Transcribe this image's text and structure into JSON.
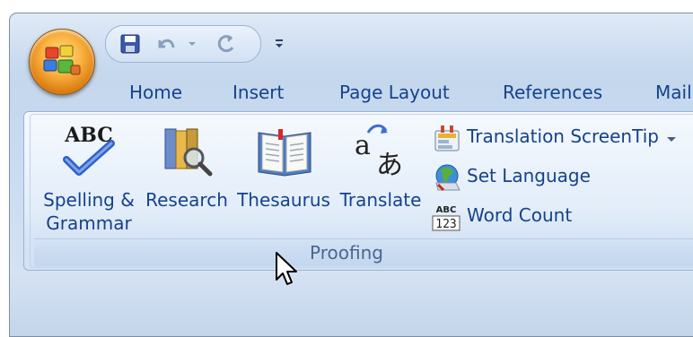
{
  "quick_access": {
    "icons": [
      "save-icon",
      "undo-icon",
      "dropdown-arrow-icon",
      "redo-icon",
      "customize-qat-icon"
    ]
  },
  "tabs": [
    {
      "label": "Home"
    },
    {
      "label": "Insert"
    },
    {
      "label": "Page Layout"
    },
    {
      "label": "References"
    },
    {
      "label": "Mail"
    }
  ],
  "group": {
    "label": "Proofing",
    "large_buttons": [
      {
        "line1": "Spelling &",
        "line2": "Grammar",
        "icon": "spelling-abc-check-icon"
      },
      {
        "line1": "Research",
        "line2": "",
        "icon": "research-books-magnifier-icon"
      },
      {
        "line1": "Thesaurus",
        "line2": "",
        "icon": "thesaurus-book-icon"
      },
      {
        "line1": "Translate",
        "line2": "",
        "icon": "translate-a-icon"
      }
    ],
    "small_buttons": [
      {
        "label": "Translation ScreenTip",
        "icon": "translation-screentip-icon",
        "has_dropdown": true
      },
      {
        "label": "Set Language",
        "icon": "set-language-globe-icon",
        "has_dropdown": false
      },
      {
        "label": "Word Count",
        "icon": "word-count-abc123-icon",
        "has_dropdown": false
      }
    ]
  },
  "abc_icon_text": "ABC",
  "wordcount_icon_text": {
    "top": "ABC",
    "bottom": "123"
  },
  "colors": {
    "tab_text": "#15428b",
    "group_label": "#4a6690",
    "office_orb": "#f9b13f",
    "check_blue": "#2f62c8"
  }
}
